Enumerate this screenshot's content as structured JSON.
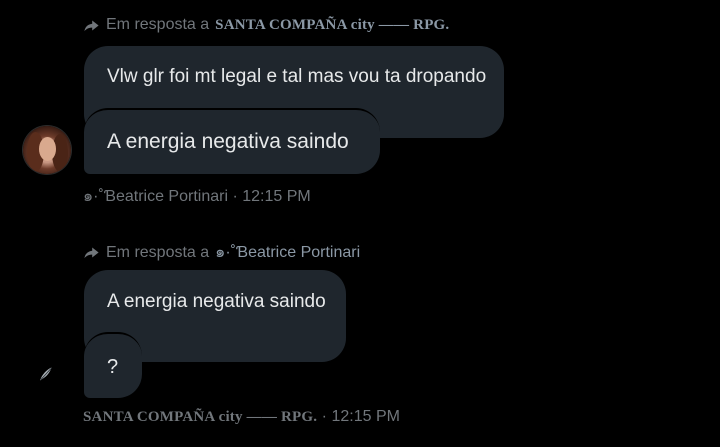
{
  "thread": {
    "reply1": {
      "prefix": "Em resposta a",
      "target": "SANTA COMPAÑA city —— RPG."
    },
    "group1": {
      "messages": [
        "Vlw glr foi mt legal e tal mas vou ta dropando",
        "A energia negativa saindo"
      ],
      "sender": "๑·˚Ɓeatrice Portinari",
      "time": "12:15 PM"
    },
    "reply2": {
      "prefix": "Em resposta a",
      "target": "๑·˚Ɓeatrice Portinari"
    },
    "group2": {
      "messages": [
        "A energia negativa saindo",
        "?"
      ],
      "sender": "SANTA COMPAÑA city —— RPG.",
      "time": "12:15 PM"
    }
  },
  "icons": {
    "reply": "reply-arrow-icon",
    "sender2_avatar": "feather-pen-icon"
  },
  "colors": {
    "background": "#000000",
    "bubble": "#1f262d",
    "text": "#e7e9ea",
    "muted": "#71767b"
  }
}
